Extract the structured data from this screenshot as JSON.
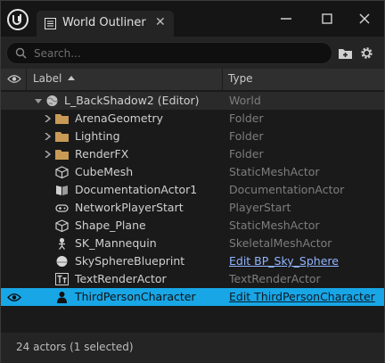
{
  "titlebar": {
    "tab_title": "World Outliner",
    "close_glyph": "✕"
  },
  "toolbar": {
    "search_placeholder": "Search..."
  },
  "columns": {
    "label": "Label",
    "type": "Type"
  },
  "rows": [
    {
      "label": "L_BackShadow2 (Editor)",
      "type": "World",
      "icon": "world-icon"
    },
    {
      "label": "ArenaGeometry",
      "type": "Folder",
      "icon": "folder-icon"
    },
    {
      "label": "Lighting",
      "type": "Folder",
      "icon": "folder-icon"
    },
    {
      "label": "RenderFX",
      "type": "Folder",
      "icon": "folder-icon"
    },
    {
      "label": "CubeMesh",
      "type": "StaticMeshActor",
      "icon": "static-mesh-icon"
    },
    {
      "label": "DocumentationActor1",
      "type": "DocumentationActor",
      "icon": "documentation-icon"
    },
    {
      "label": "NetworkPlayerStart",
      "type": "PlayerStart",
      "icon": "player-start-icon"
    },
    {
      "label": "Shape_Plane",
      "type": "StaticMeshActor",
      "icon": "static-mesh-icon"
    },
    {
      "label": "SK_Mannequin",
      "type": "SkeletalMeshActor",
      "icon": "skeletal-mesh-icon"
    },
    {
      "label": "SkySphereBlueprint",
      "type": "Edit BP_Sky_Sphere",
      "icon": "sky-sphere-icon"
    },
    {
      "label": "TextRenderActor",
      "type": "TextRenderActor",
      "icon": "text-render-icon"
    },
    {
      "label": "ThirdPersonCharacter",
      "type": "Edit ThirdPersonCharacter",
      "icon": "character-icon"
    }
  ],
  "footer": {
    "status": "24 actors (1 selected)"
  },
  "colors": {
    "selection": "#18a6e6",
    "link": "#8fb4ff",
    "folder": "#c89a55"
  }
}
